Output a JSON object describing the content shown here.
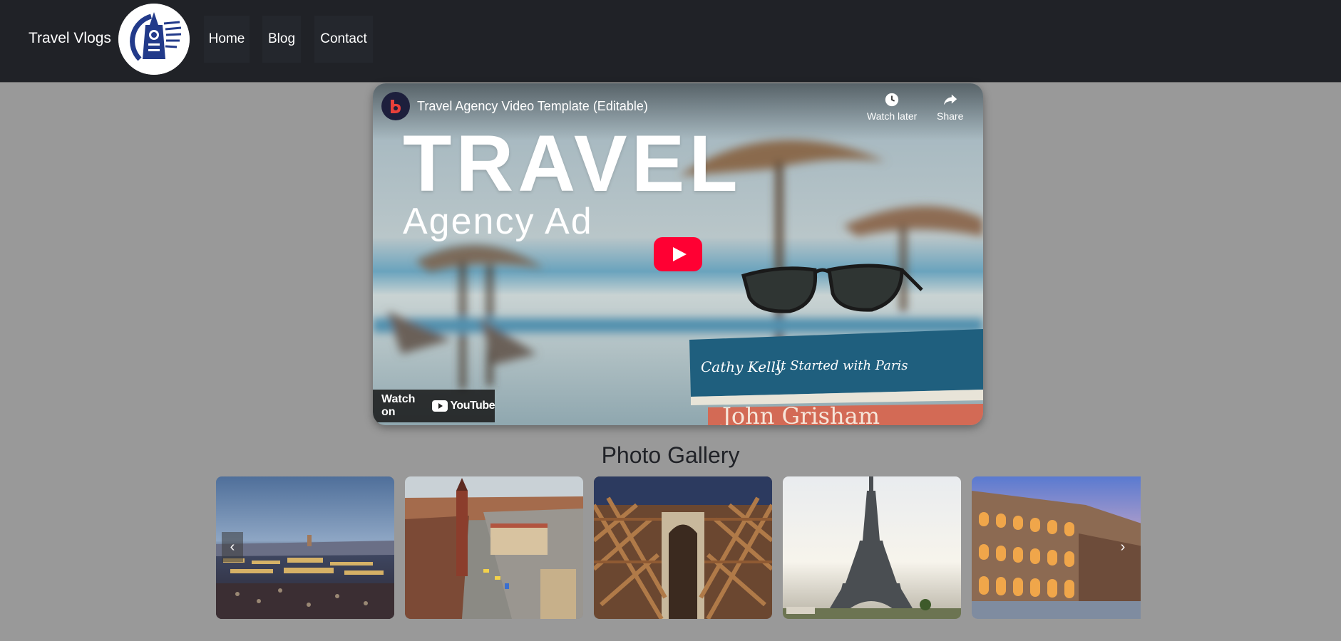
{
  "navbar": {
    "brand": "Travel Vlogs",
    "items": [
      {
        "label": "Home"
      },
      {
        "label": "Blog"
      },
      {
        "label": "Contact"
      }
    ],
    "logo_icon": "big-ben-globe-logo"
  },
  "video": {
    "title": "Travel Agency Video Template (Editable)",
    "thumbnail_heading": "TRAVEL",
    "thumbnail_subheading": "Agency Ad",
    "watch_later_label": "Watch later",
    "share_label": "Share",
    "watch_on_label": "Watch on",
    "youtube_word": "YouTube",
    "colors": {
      "play": "#ff0033"
    }
  },
  "gallery": {
    "heading": "Photo Gallery",
    "photos": [
      {
        "subject": "market-square-dusk"
      },
      {
        "subject": "old-town-square-aerial"
      },
      {
        "subject": "wooden-scaffold-arch"
      },
      {
        "subject": "eiffel-tower"
      },
      {
        "subject": "colosseum"
      }
    ],
    "prev_icon": "chevron-left-icon",
    "next_icon": "chevron-right-icon"
  },
  "colors": {
    "navbar": "#202227",
    "page_bg": "#999999",
    "nav_item_bg": "#24272d"
  }
}
